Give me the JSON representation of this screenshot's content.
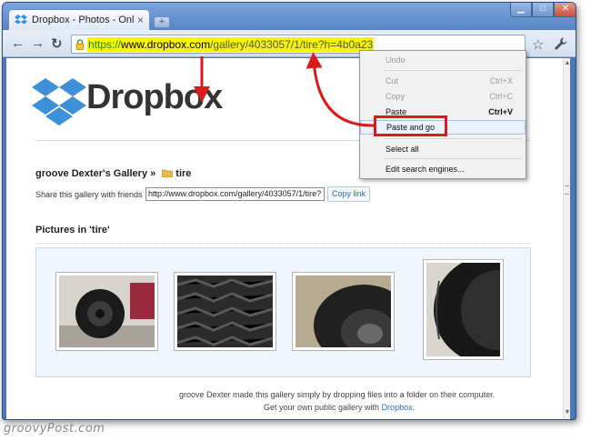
{
  "browser": {
    "tab_title": "Dropbox - Photos - Onlin…",
    "tab_close": "×",
    "new_tab": "+",
    "window_controls": {
      "minimize": "▁",
      "maximize": "□",
      "close": "✕"
    },
    "nav": {
      "back": "←",
      "forward": "→",
      "reload": "↻"
    },
    "url": {
      "scheme": "https://",
      "host": "www.dropbox.com",
      "path": "/gallery/4033057/1/tire?h=4b0a23"
    },
    "star": "☆"
  },
  "page": {
    "logo_text": "Dropbox",
    "gallery_title_prefix": "groove Dexter's Gallery » ",
    "gallery_title_folder": "tire",
    "share_label": "Share this gallery with friends",
    "share_url": "http://www.dropbox.com/gallery/4033057/1/tire?",
    "copy_button": "Copy link",
    "pictures_title": "Pictures in 'tire'",
    "footer_line1": "groove Dexter made this gallery simply by dropping files into a folder on their computer.",
    "footer_line2_prefix": "Get your own public gallery with ",
    "footer_link": "Dropbox",
    "footer_line2_suffix": "."
  },
  "context_menu": {
    "items": [
      {
        "label": "Undo",
        "shortcut": "",
        "enabled": false
      },
      {
        "label": "Cut",
        "shortcut": "Ctrl+X",
        "enabled": false
      },
      {
        "label": "Copy",
        "shortcut": "Ctrl+C",
        "enabled": false
      },
      {
        "label": "Paste",
        "shortcut": "Ctrl+V",
        "enabled": true
      },
      {
        "label": "Paste and go",
        "shortcut": "",
        "enabled": true
      },
      {
        "label": "Select all",
        "shortcut": "",
        "enabled": true
      },
      {
        "label": "Edit search engines...",
        "shortcut": "",
        "enabled": true
      }
    ]
  },
  "watermark": "groovyPost.com",
  "colors": {
    "url_highlight": "#f7f500",
    "annotation_red": "#dd1a1a",
    "dropbox_blue": "#3d8fd8",
    "link_blue": "#2e6db4"
  }
}
